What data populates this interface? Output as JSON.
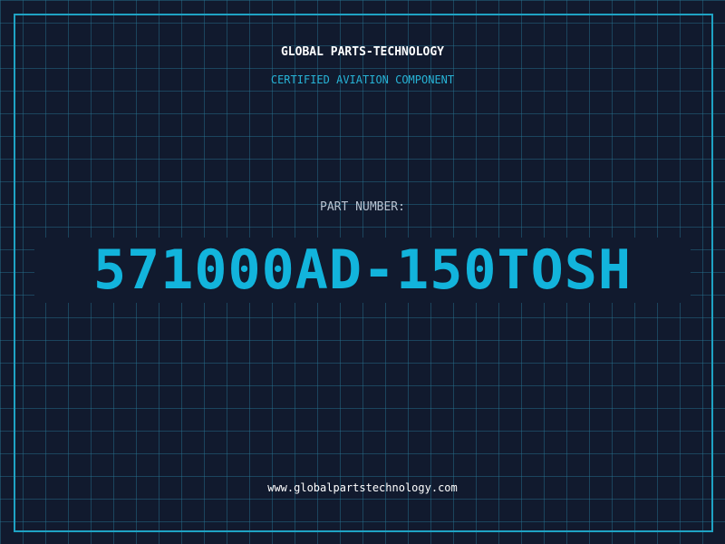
{
  "header": {
    "company": "GLOBAL PARTS-TECHNOLOGY",
    "subtitle": "CERTIFIED AVIATION COMPONENT"
  },
  "part": {
    "label": "PART NUMBER:",
    "number": "571000AD-150TOSH"
  },
  "footer": {
    "website": "www.globalpartstechnology.com"
  },
  "colors": {
    "background": "#111a2e",
    "accent": "#12b4dc",
    "grid": "#28789a"
  }
}
